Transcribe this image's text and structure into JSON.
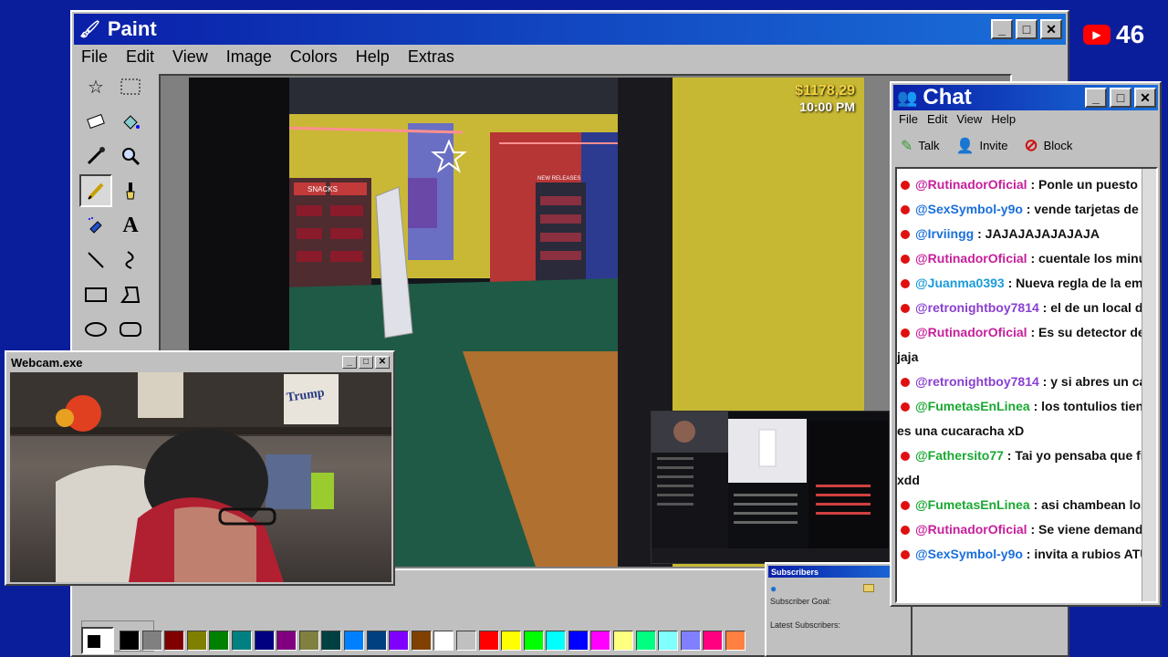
{
  "paint": {
    "title": "Paint",
    "menu": [
      "File",
      "Edit",
      "View",
      "Image",
      "Colors",
      "Help",
      "Extras"
    ],
    "tools": [
      "free-select-icon",
      "rect-select-icon",
      "eraser-icon",
      "fill-icon",
      "picker-icon",
      "magnifier-icon",
      "pencil-icon",
      "brush-icon",
      "airbrush-icon",
      "text-icon",
      "line-icon",
      "curve-icon",
      "rect-icon",
      "polygon-icon",
      "ellipse-icon",
      "rounded-rect-icon"
    ],
    "palette": [
      "#000000",
      "#808080",
      "#800000",
      "#808000",
      "#008000",
      "#008080",
      "#000080",
      "#800080",
      "#808040",
      "#004040",
      "#0080ff",
      "#004080",
      "#8000ff",
      "#804000",
      "#ffffff",
      "#c0c0c0",
      "#ff0000",
      "#ffff00",
      "#00ff00",
      "#00ffff",
      "#0000ff",
      "#ff00ff",
      "#ffff80",
      "#00ff80",
      "#80ffff",
      "#8080ff",
      "#ff0080",
      "#ff8040"
    ]
  },
  "game": {
    "money": "$1178,29",
    "time": "10:00 PM",
    "sign_snacks": "SNACKS",
    "sign_new": "NEW RELEASES"
  },
  "youtube": {
    "count": "46"
  },
  "chat": {
    "title": "Chat",
    "menu": [
      "File",
      "Edit",
      "View",
      "Help"
    ],
    "tools": {
      "talk": "Talk",
      "invite": "Invite",
      "block": "Block"
    },
    "messages": [
      {
        "user": "@RutinadorOficial",
        "color": "#c71f9c",
        "text": " : Ponle un puesto de ques"
      },
      {
        "user": "@SexSymbol-y9o",
        "color": "#1a6fd9",
        "text": " : vende tarjetas de Pokém"
      },
      {
        "user": "@Irviingg",
        "color": "#1a6fd9",
        "text": " : JAJAJAJAJAJAJA"
      },
      {
        "user": "@RutinadorOficial",
        "color": "#c71f9c",
        "text": " : cuentale los minutos"
      },
      {
        "user": "@Juanma0393",
        "color": "#1a9bd9",
        "text": " : Nueva regla de la empres"
      },
      {
        "user": "@retronightboy7814",
        "color": "#8a3fd1",
        "text": " : el de un local de carti"
      },
      {
        "user": "@RutinadorOficial",
        "color": "#c71f9c",
        "text": " : Es su detector de menti"
      },
      {
        "user": "",
        "color": "#111",
        "text": "jaja"
      },
      {
        "user": "@retronightboy7814",
        "color": "#8a3fd1",
        "text": " : y si abres un café inte"
      },
      {
        "user": "@FumetasEnLinea",
        "color": "#1aa832",
        "text": " : los tontulios tienen mie"
      },
      {
        "user": "",
        "color": "#111",
        "text": "es una cucaracha xD"
      },
      {
        "user": "@Fathersito77",
        "color": "#1aa832",
        "text": " : Tai yo pensaba que fifita era"
      },
      {
        "user": "",
        "color": "#111",
        "text": "xdd"
      },
      {
        "user": "@FumetasEnLinea",
        "color": "#1aa832",
        "text": " : asi chambean los jefes"
      },
      {
        "user": "@RutinadorOficial",
        "color": "#c71f9c",
        "text": " : Se viene demanda"
      },
      {
        "user": "@SexSymbol-y9o",
        "color": "#1a6fd9",
        "text": " : invita a rubios ATU t end"
      }
    ]
  },
  "webcam": {
    "title": "Webcam.exe",
    "poster": "Trump"
  },
  "subscribers": {
    "title": "Subscribers",
    "goal": "Subscriber Goal:",
    "latest": "Latest Subscribers:"
  }
}
